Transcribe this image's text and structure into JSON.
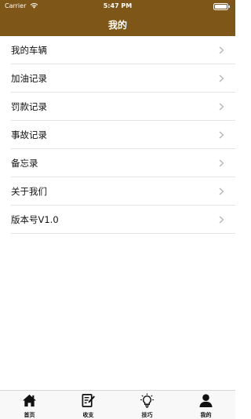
{
  "status_bar": {
    "carrier": "Carrier",
    "time": "5:47 PM"
  },
  "header": {
    "title": "我的",
    "background_color": "#7d5618"
  },
  "menu": {
    "items": [
      {
        "label": "我的车辆",
        "icon": "chevron-right-icon"
      },
      {
        "label": "加油记录",
        "icon": "chevron-right-icon"
      },
      {
        "label": "罚款记录",
        "icon": "chevron-right-icon"
      },
      {
        "label": "事故记录",
        "icon": "chevron-right-icon"
      },
      {
        "label": "备忘录",
        "icon": "chevron-right-icon"
      },
      {
        "label": "关于我们",
        "icon": "chevron-right-icon"
      },
      {
        "label": "版本号V1.0",
        "icon": "chevron-right-icon"
      }
    ]
  },
  "tab_bar": {
    "tabs": [
      {
        "label": "首页",
        "icon": "home-icon"
      },
      {
        "label": "收支",
        "icon": "edit-note-icon"
      },
      {
        "label": "技巧",
        "icon": "lightbulb-icon"
      },
      {
        "label": "我的",
        "icon": "person-icon",
        "active": true
      }
    ]
  }
}
